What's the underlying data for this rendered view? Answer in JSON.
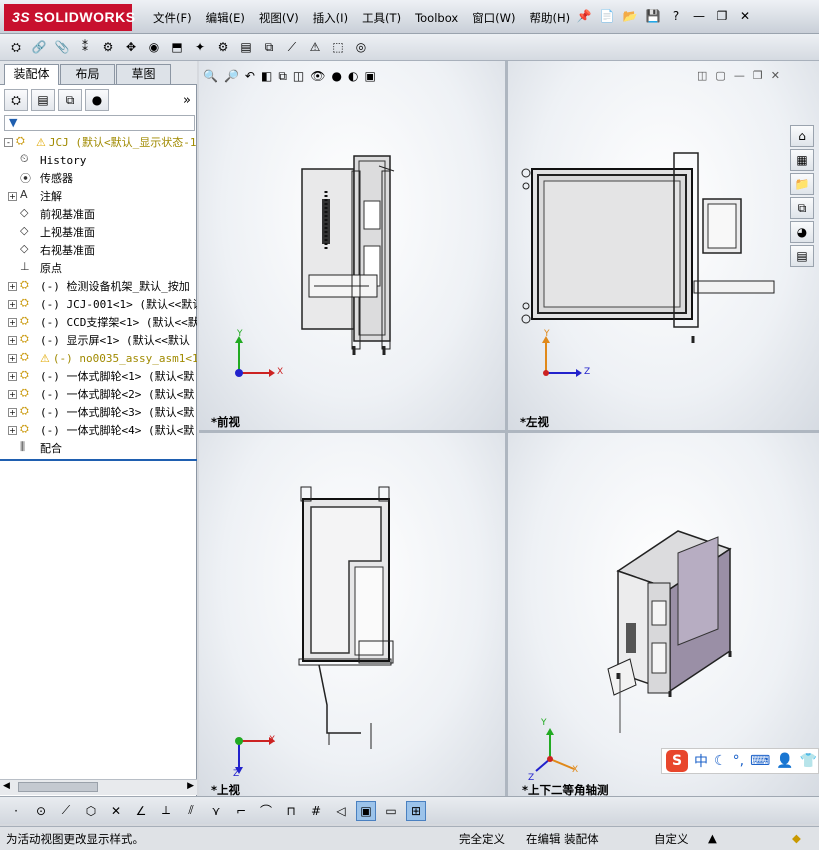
{
  "app": {
    "logo": "SOLIDWORKS",
    "logo_prefix": "3S"
  },
  "menu": [
    "文件(F)",
    "编辑(E)",
    "视图(V)",
    "插入(I)",
    "工具(T)",
    "Toolbox",
    "窗口(W)",
    "帮助(H)"
  ],
  "panel": {
    "tabs": [
      "装配体",
      "布局",
      "草图"
    ],
    "tree": [
      {
        "label": "JCJ  (默认<默认_显示状态-1",
        "expander": "-",
        "warn": true,
        "indent": 0,
        "icon": "assembly-icon"
      },
      {
        "label": "History",
        "expander": "",
        "indent": 1,
        "icon": "history-icon"
      },
      {
        "label": "传感器",
        "expander": "",
        "indent": 1,
        "icon": "sensor-icon"
      },
      {
        "label": "注解",
        "expander": "+",
        "indent": 1,
        "icon": "annotation-icon"
      },
      {
        "label": "前视基准面",
        "expander": "",
        "indent": 1,
        "icon": "plane-icon"
      },
      {
        "label": "上视基准面",
        "expander": "",
        "indent": 1,
        "icon": "plane-icon"
      },
      {
        "label": "右视基准面",
        "expander": "",
        "indent": 1,
        "icon": "plane-icon"
      },
      {
        "label": "原点",
        "expander": "",
        "indent": 1,
        "icon": "origin-icon"
      },
      {
        "label": "(-) 检测设备机架_默认_按加",
        "expander": "+",
        "indent": 1,
        "icon": "part-icon"
      },
      {
        "label": "(-) JCJ-001<1> (默认<<默认",
        "expander": "+",
        "indent": 1,
        "icon": "part-icon"
      },
      {
        "label": "(-) CCD支撑架<1> (默认<<默",
        "expander": "+",
        "indent": 1,
        "icon": "part-icon"
      },
      {
        "label": "(-) 显示屏<1> (默认<<默认",
        "expander": "+",
        "indent": 1,
        "icon": "part-icon"
      },
      {
        "label": "(-) no0035_assy_asm1<1>",
        "expander": "+",
        "warn": true,
        "indent": 1,
        "icon": "part-icon"
      },
      {
        "label": "(-) 一体式脚轮<1> (默认<默",
        "expander": "+",
        "indent": 1,
        "icon": "part-icon"
      },
      {
        "label": "(-) 一体式脚轮<2> (默认<默",
        "expander": "+",
        "indent": 1,
        "icon": "part-icon"
      },
      {
        "label": "(-) 一体式脚轮<3> (默认<默",
        "expander": "+",
        "indent": 1,
        "icon": "part-icon"
      },
      {
        "label": "(-) 一体式脚轮<4> (默认<默",
        "expander": "+",
        "indent": 1,
        "icon": "part-icon"
      },
      {
        "label": "配合",
        "expander": "",
        "indent": 1,
        "icon": "mate-icon"
      }
    ]
  },
  "viewports": {
    "front": "*前视",
    "left": "*左视",
    "top": "*上视",
    "iso": "*上下二等角轴测"
  },
  "axes": {
    "x": "X",
    "y": "Y",
    "z": "Z"
  },
  "status": {
    "hint": "为活动视图更改显示样式。",
    "definition": "完全定义",
    "mode": "在编辑 装配体",
    "units": "自定义"
  },
  "ime": {
    "logo": "S",
    "lang": "中"
  }
}
